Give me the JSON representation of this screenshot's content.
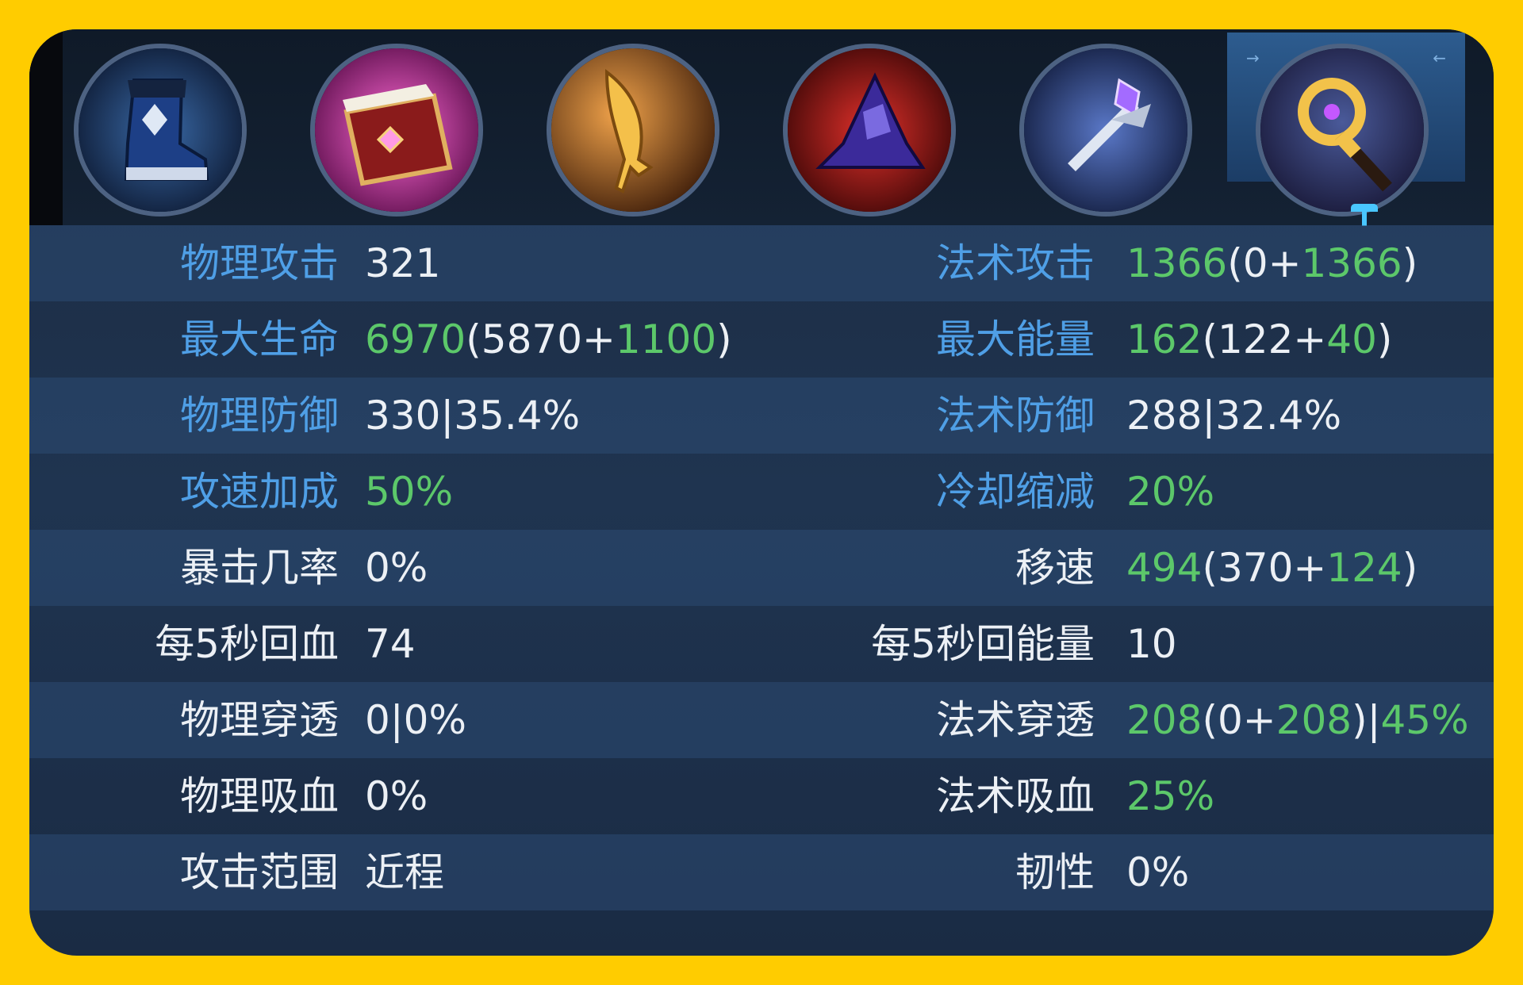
{
  "items": [
    {
      "icon": "boots-icon"
    },
    {
      "icon": "spellbook-icon"
    },
    {
      "icon": "golden-dagger-icon"
    },
    {
      "icon": "mage-hat-icon"
    },
    {
      "icon": "crystal-scepter-icon"
    },
    {
      "icon": "golden-staff-icon",
      "selected": true
    }
  ],
  "stats": [
    {
      "left": {
        "label": "物理攻击",
        "parts": [
          {
            "t": "321",
            "c": "w"
          }
        ]
      },
      "right": {
        "label": "法术攻击",
        "parts": [
          {
            "t": "1366",
            "c": "g"
          },
          {
            "t": "(0+",
            "c": "w"
          },
          {
            "t": "1366",
            "c": "g"
          },
          {
            "t": ")",
            "c": "w"
          }
        ]
      }
    },
    {
      "left": {
        "label": "最大生命",
        "parts": [
          {
            "t": "6970",
            "c": "g"
          },
          {
            "t": "(5870+",
            "c": "w"
          },
          {
            "t": "1100",
            "c": "g"
          },
          {
            "t": ")",
            "c": "w"
          }
        ]
      },
      "right": {
        "label": "最大能量",
        "parts": [
          {
            "t": "162",
            "c": "g"
          },
          {
            "t": "(122+",
            "c": "w"
          },
          {
            "t": "40",
            "c": "g"
          },
          {
            "t": ")",
            "c": "w"
          }
        ]
      }
    },
    {
      "left": {
        "label": "物理防御",
        "parts": [
          {
            "t": "330|35.4%",
            "c": "w"
          }
        ]
      },
      "right": {
        "label": "法术防御",
        "parts": [
          {
            "t": "288|32.4%",
            "c": "w"
          }
        ]
      }
    },
    {
      "left": {
        "label": "攻速加成",
        "parts": [
          {
            "t": "50%",
            "c": "g"
          }
        ]
      },
      "right": {
        "label": "冷却缩减",
        "parts": [
          {
            "t": "20%",
            "c": "g"
          }
        ]
      }
    },
    {
      "left": {
        "label": "暴击几率",
        "parts": [
          {
            "t": "0%",
            "c": "w"
          }
        ]
      },
      "right": {
        "label": "移速",
        "parts": [
          {
            "t": "494",
            "c": "g"
          },
          {
            "t": "(370+",
            "c": "w"
          },
          {
            "t": "124",
            "c": "g"
          },
          {
            "t": ")",
            "c": "w"
          }
        ]
      }
    },
    {
      "left": {
        "label": "每5秒回血",
        "parts": [
          {
            "t": "74",
            "c": "w"
          }
        ]
      },
      "right": {
        "label": "每5秒回能量",
        "parts": [
          {
            "t": "10",
            "c": "w"
          }
        ]
      }
    },
    {
      "left": {
        "label": "物理穿透",
        "parts": [
          {
            "t": "0|0%",
            "c": "w"
          }
        ]
      },
      "right": {
        "label": "法术穿透",
        "parts": [
          {
            "t": "208",
            "c": "g"
          },
          {
            "t": "(0+",
            "c": "w"
          },
          {
            "t": "208",
            "c": "g"
          },
          {
            "t": ")|",
            "c": "w"
          },
          {
            "t": "45%",
            "c": "g"
          }
        ]
      }
    },
    {
      "left": {
        "label": "物理吸血",
        "parts": [
          {
            "t": "0%",
            "c": "w"
          }
        ]
      },
      "right": {
        "label": "法术吸血",
        "parts": [
          {
            "t": "25%",
            "c": "g"
          }
        ]
      }
    },
    {
      "left": {
        "label": "攻击范围",
        "parts": [
          {
            "t": "近程",
            "c": "w"
          }
        ]
      },
      "right": {
        "label": "韧性",
        "parts": [
          {
            "t": "0%",
            "c": "w"
          }
        ]
      }
    }
  ],
  "label_colors": {
    "blue_rows": [
      0,
      1,
      2,
      3
    ],
    "blue": "#4f9fe6",
    "white": "#ecf0f5",
    "green": "#5cc86a"
  }
}
